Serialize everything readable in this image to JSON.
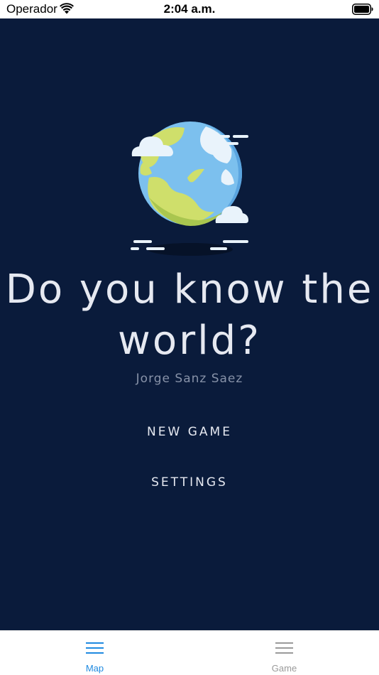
{
  "status_bar": {
    "carrier": "Operador",
    "time": "2:04 a.m.",
    "wifi_icon": "wifi-icon",
    "battery_icon": "battery-icon"
  },
  "main": {
    "background": "#0a1b3b",
    "illustration": "globe-icon",
    "title": "Do you know the world?",
    "author": "Jorge Sanz Saez",
    "buttons": {
      "new_game": "NEW GAME",
      "settings": "SETTINGS"
    }
  },
  "tab_bar": {
    "tabs": [
      {
        "label": "Map",
        "icon": "menu-icon",
        "selected": true,
        "color": "#1f8ae0"
      },
      {
        "label": "Game",
        "icon": "menu-icon",
        "selected": false,
        "color": "#9a9a9a"
      }
    ]
  }
}
